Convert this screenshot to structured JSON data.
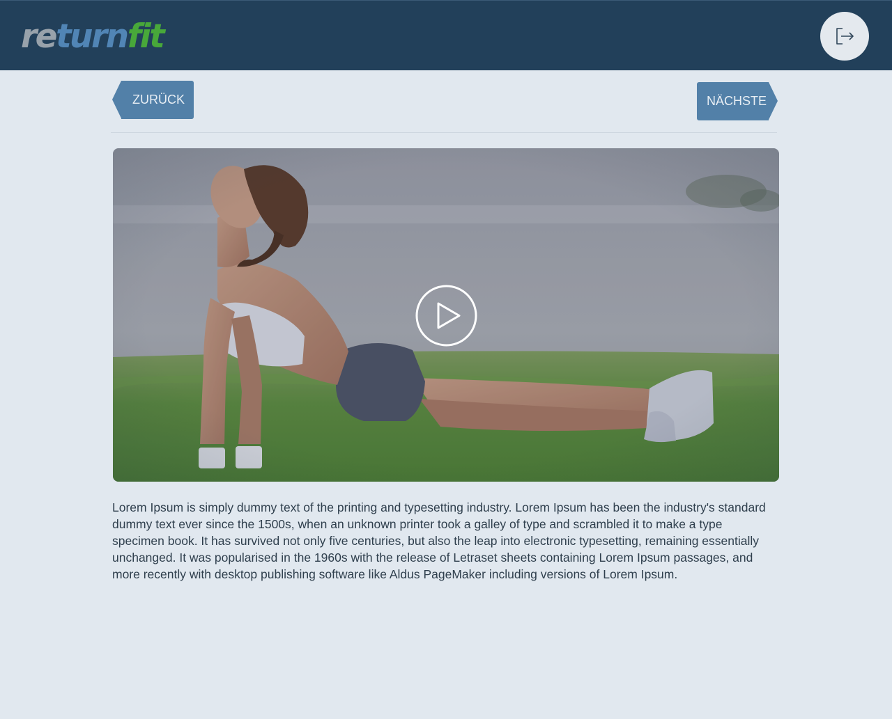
{
  "header": {
    "logo": {
      "part1": "re",
      "part2": "turn",
      "part3": "fit"
    },
    "logout_icon": "logout-icon"
  },
  "navigation": {
    "back_label": "ZURÜCK",
    "next_label": "NÄCHSTE"
  },
  "video": {
    "thumbnail": "woman-yoga-upward-dog-on-grass",
    "play_icon": "play-icon"
  },
  "content": {
    "description": "Lorem Ipsum is simply dummy text of the printing and typesetting industry. Lorem Ipsum has been the industry's standard dummy text ever since the 1500s, when an unknown printer took a galley of type and scrambled it to make a type specimen book. It has survived not only five centuries, but also the leap into electronic typesetting, remaining essentially unchanged. It was popularised in the 1960s with the release of Letraset sheets containing Lorem Ipsum passages, and more recently with desktop publishing software like Aldus PageMaker including versions of Lorem Ipsum."
  },
  "colors": {
    "header_bg": "#22405a",
    "page_bg": "#e1e8ef",
    "button_bg": "#5280a8",
    "logo_gray": "#98a2ab",
    "logo_blue": "#5185b5",
    "logo_green": "#48a83a"
  }
}
